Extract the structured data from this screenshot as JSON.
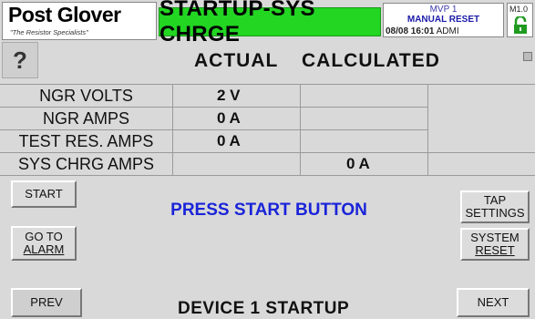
{
  "header": {
    "logo_text": "Post Glover",
    "logo_tagline": "\"The Resistor Specialists\"",
    "title": "STARTUP-SYS CHRGE",
    "status_line1": "MVP 1",
    "status_line2": "MANUAL RESET",
    "status_date": "08/08 16:01",
    "status_user": "ADMI",
    "revision": "M1.0",
    "help_symbol": "?"
  },
  "table": {
    "col_actual": "ACTUAL",
    "col_calculated": "CALCULATED",
    "rows": [
      {
        "label": "NGR VOLTS",
        "actual": "2 V",
        "calculated": ""
      },
      {
        "label": "NGR AMPS",
        "actual": "0 A",
        "calculated": ""
      },
      {
        "label": "TEST RES. AMPS",
        "actual": "0 A",
        "calculated": ""
      },
      {
        "label": "SYS CHRG AMPS",
        "actual": "",
        "calculated": "0 A"
      }
    ]
  },
  "buttons": {
    "start": "START",
    "goto_alarm_1": "GO TO",
    "goto_alarm_2": "ALARM",
    "tap_settings_1": "TAP",
    "tap_settings_2": "SETTINGS",
    "system_reset_1": "SYSTEM",
    "system_reset_2": "RESET",
    "prev": "PREV",
    "next": "NEXT"
  },
  "message": "PRESS START BUTTON",
  "footer": "DEVICE 1 STARTUP",
  "colors": {
    "title_bg": "#22d622",
    "message": "#1a24d8",
    "lock": "#1f9a1f"
  }
}
